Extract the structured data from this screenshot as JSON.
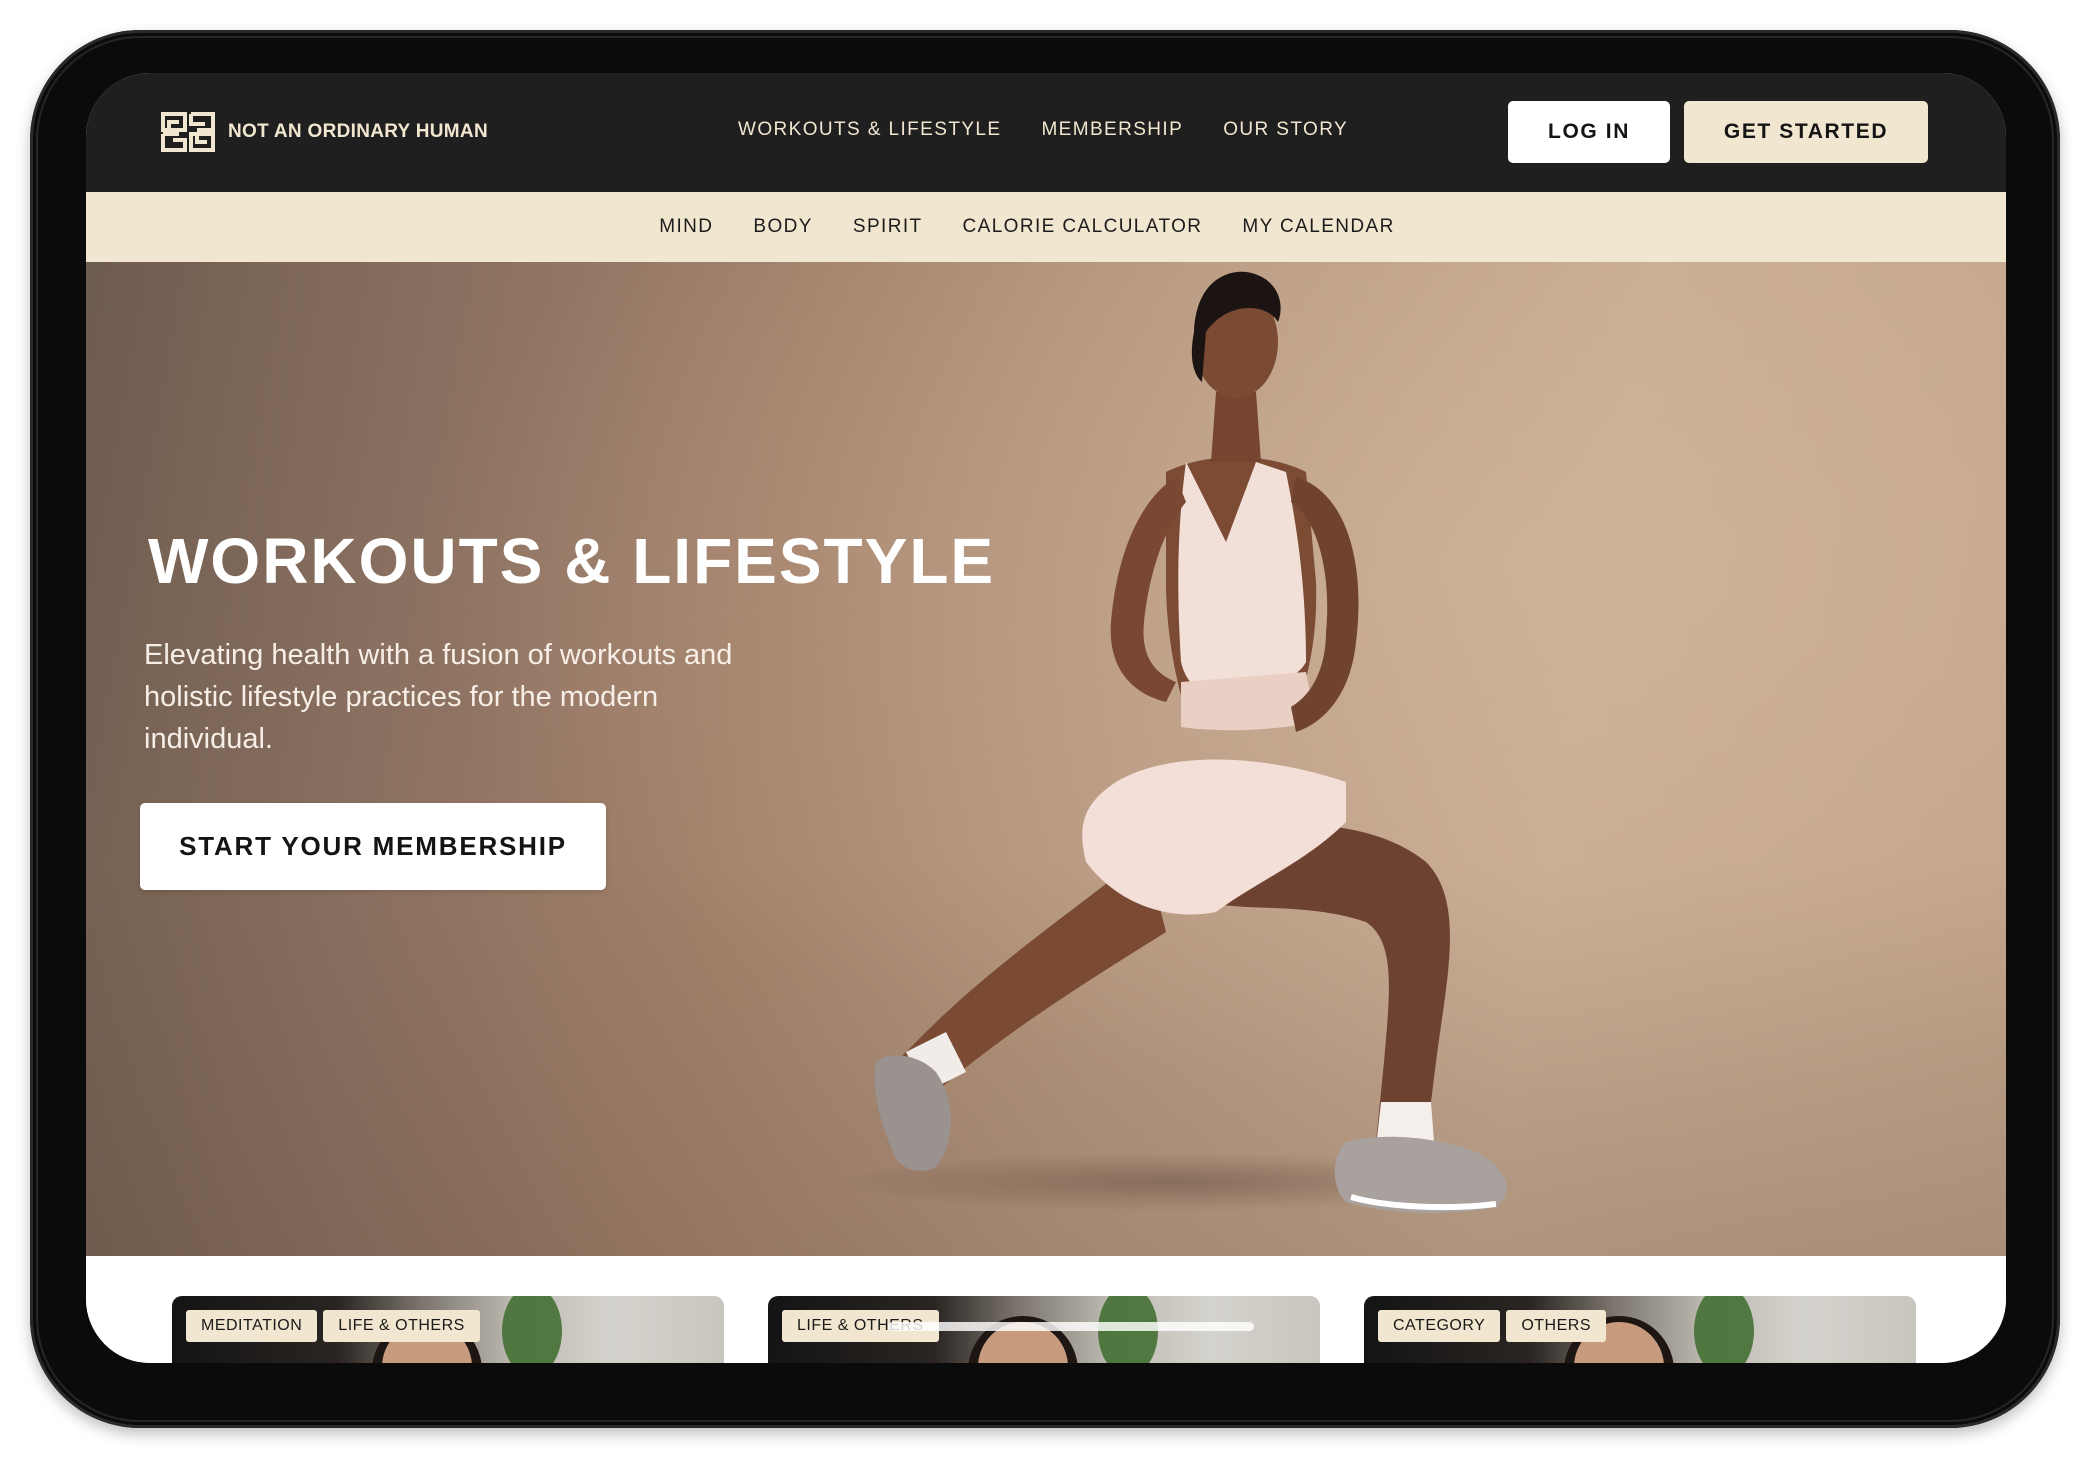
{
  "brand": {
    "name": "NOT AN ORDINARY HUMAN",
    "logo_icon": "interlocking-squares-logo-icon"
  },
  "colors": {
    "nav_bg": "#1f1f1f",
    "accent_cream": "#f1e6cf",
    "button_white": "#ffffff",
    "text_dark": "#141414"
  },
  "topnav": {
    "links": [
      {
        "label": "WORKOUTS & LIFESTYLE"
      },
      {
        "label": "MEMBERSHIP"
      },
      {
        "label": "OUR STORY"
      }
    ],
    "login_label": "LOG IN",
    "get_started_label": "GET STARTED"
  },
  "subnav": {
    "links": [
      {
        "label": "MIND"
      },
      {
        "label": "BODY"
      },
      {
        "label": "SPIRIT"
      },
      {
        "label": "CALORIE CALCULATOR"
      },
      {
        "label": "MY CALENDAR"
      }
    ]
  },
  "hero": {
    "title": "WORKOUTS & LIFESTYLE",
    "subtitle": "Elevating health with a fusion of workouts and holistic lifestyle practices for the modern individual.",
    "cta_label": "START YOUR MEMBERSHIP",
    "image_description": "woman in light pink athletic wear doing a lunge stretch"
  },
  "cards": [
    {
      "tags": [
        "MEDITATION",
        "LIFE & OTHERS"
      ]
    },
    {
      "tags": [
        "LIFE & OTHERS"
      ]
    },
    {
      "tags": [
        "CATEGORY",
        "OTHERS"
      ]
    }
  ]
}
